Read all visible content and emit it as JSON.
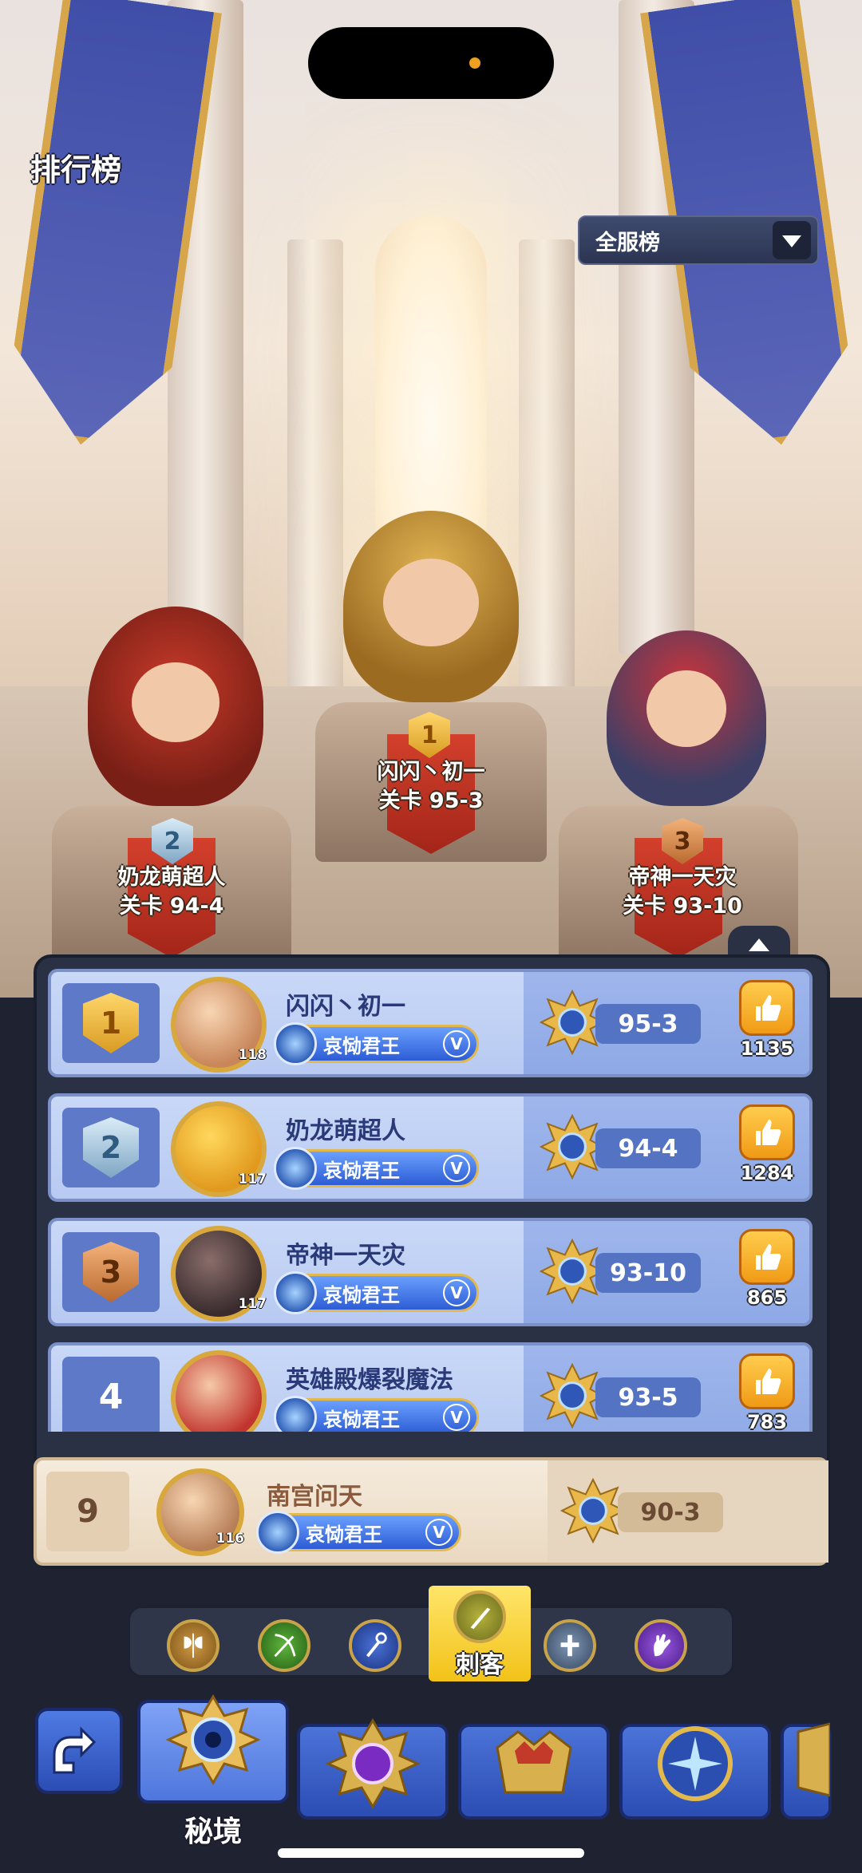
{
  "header": {
    "title": "排行榜",
    "scope_dropdown": {
      "selected": "全服榜"
    }
  },
  "podium": [
    {
      "rank": "1",
      "name": "闪闪丶初一",
      "stage": "关卡 95-3"
    },
    {
      "rank": "2",
      "name": "奶龙萌超人",
      "stage": "关卡 94-4"
    },
    {
      "rank": "3",
      "name": "帝神一天灾",
      "stage": "关卡 93-10"
    }
  ],
  "ranking_list": [
    {
      "rank": "1",
      "name": "闪闪丶初一",
      "level": "118",
      "title": "哀恸君王",
      "title_tier": "V",
      "stage": "95-3",
      "likes": "1135"
    },
    {
      "rank": "2",
      "name": "奶龙萌超人",
      "level": "117",
      "title": "哀恸君王",
      "title_tier": "V",
      "stage": "94-4",
      "likes": "1284"
    },
    {
      "rank": "3",
      "name": "帝神一天灾",
      "level": "117",
      "title": "哀恸君王",
      "title_tier": "V",
      "stage": "93-10",
      "likes": "865"
    },
    {
      "rank": "4",
      "name": "英雄殿爆裂魔法",
      "level": "",
      "title": "哀恸君王",
      "title_tier": "V",
      "stage": "93-5",
      "likes": "783"
    }
  ],
  "my_rank": {
    "rank": "9",
    "name": "南宫问天",
    "level": "116",
    "title": "哀恸君王",
    "title_tier": "V",
    "stage": "90-3"
  },
  "class_filter": {
    "selected": "刺客",
    "items": [
      {
        "icon": "warrior-axe-icon"
      },
      {
        "icon": "archer-bow-icon"
      },
      {
        "icon": "mage-staff-icon"
      },
      {
        "icon": "assassin-blade-icon",
        "label": "刺客"
      },
      {
        "icon": "priest-cross-icon"
      },
      {
        "icon": "summoner-hand-icon"
      }
    ]
  },
  "bottom_tabs": [
    {
      "icon": "secret-realm-emblem-icon",
      "label": "秘境"
    },
    {
      "icon": "purple-orb-emblem-icon"
    },
    {
      "icon": "crown-emblem-icon"
    },
    {
      "icon": "blue-star-emblem-icon"
    },
    {
      "icon": "partial-emblem-icon"
    }
  ],
  "colors": {
    "row_bg": "#c9d8f7",
    "rank_cell": "#5e79c7",
    "my_row_bg": "#f5ebdc",
    "like_gold": "#ffcc4d",
    "tab_blue": "#2b4db4",
    "class_selected": "#f2c218"
  }
}
